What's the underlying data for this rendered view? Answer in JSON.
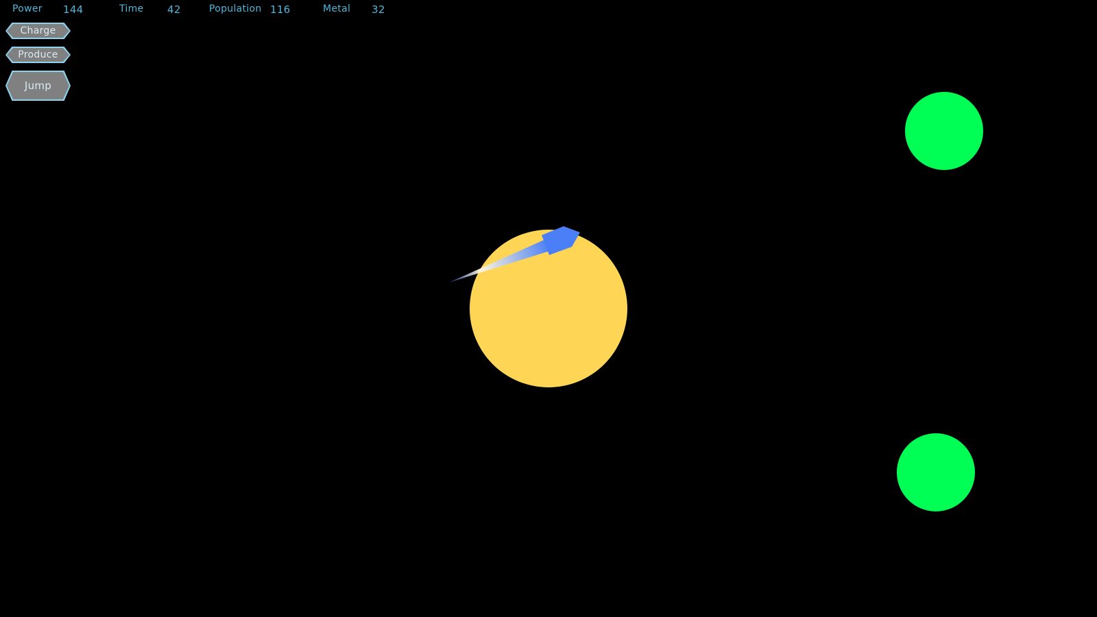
{
  "hud": {
    "power": {
      "label": "Power",
      "value": "144"
    },
    "time": {
      "label": "Time",
      "value": "42"
    },
    "population": {
      "label": "Population",
      "value": "116"
    },
    "metal": {
      "label": "Metal",
      "value": "32"
    }
  },
  "buttons": {
    "charge": "Charge",
    "produce": "Produce",
    "jump": "Jump"
  },
  "colors": {
    "background": "#000000",
    "hud_text": "#4fb6d8",
    "button_border": "#8ad4f0",
    "button_fill": "#808080",
    "star": "#ffd556",
    "planet": "#00ff55",
    "ship": "#4a7ff7"
  },
  "scene": {
    "icons": [
      "star",
      "planet",
      "planet",
      "ship"
    ]
  }
}
